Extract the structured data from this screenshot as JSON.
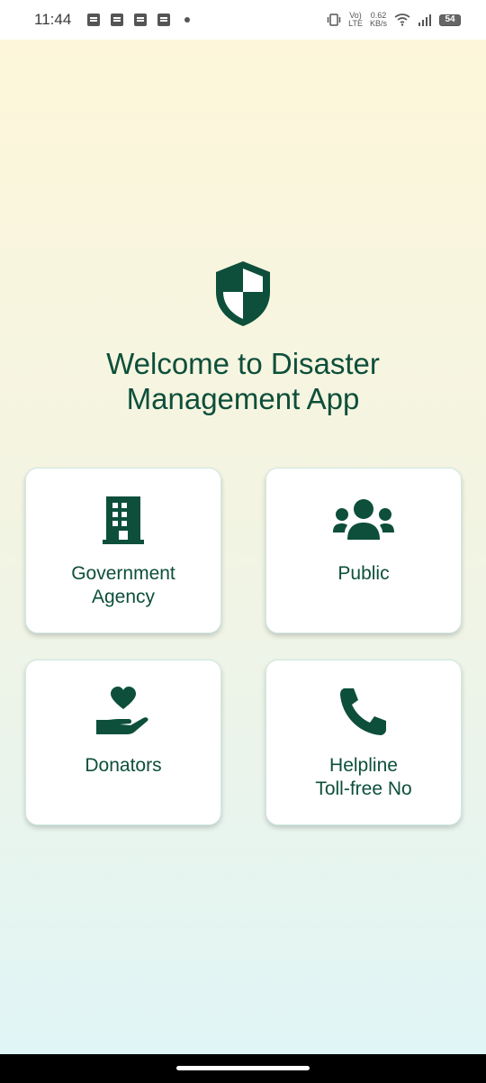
{
  "status_bar": {
    "time": "11:44",
    "network_speed_value": "0.62",
    "network_speed_unit": "KB/s",
    "battery": "54",
    "volte": "Vo)",
    "lte": "LTE"
  },
  "colors": {
    "primary": "#0d4f3b",
    "gradient_top": "#fdf6da",
    "gradient_bottom": "#e0f5f6"
  },
  "welcome": {
    "line1": "Welcome to Disaster",
    "line2": "Management App",
    "logo_icon": "shield-icon"
  },
  "cards": [
    {
      "label": "Government\nAgency",
      "icon": "building-icon"
    },
    {
      "label": "Public",
      "icon": "people-group-icon"
    },
    {
      "label": "Donators",
      "icon": "hand-heart-icon"
    },
    {
      "label": "Helpline\nToll-free No",
      "icon": "phone-icon"
    }
  ]
}
